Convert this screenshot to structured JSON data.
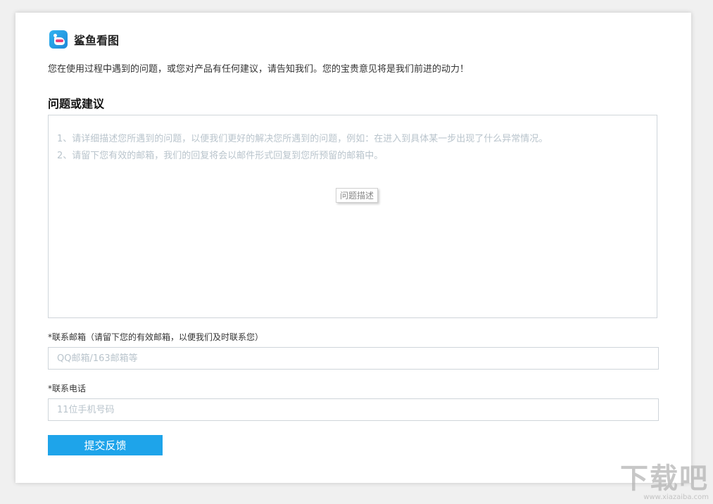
{
  "app": {
    "name": "鲨鱼看图",
    "logo_icon": "shark-logo-icon"
  },
  "intro_text": "您在使用过程中遇到的问题，或您对产品有任何建议，请告知我们。您的宝贵意见将是我们前进的动力！",
  "feedback": {
    "section_title": "问题或建议",
    "placeholder_line1": "1、请详细描述您所遇到的问题，以便我们更好的解决您所遇到的问题，例如：在进入到具体某一步出现了什么异常情况。",
    "placeholder_line2": "2、请留下您有效的邮箱，我们的回复将会以邮件形式回复到您所预留的邮箱中。",
    "tooltip": "问题描述"
  },
  "email": {
    "label": "*联系邮箱（请留下您的有效邮箱，以便我们及时联系您）",
    "placeholder": "QQ邮箱/163邮箱等",
    "value": ""
  },
  "phone": {
    "label": "*联系电话",
    "placeholder": "11位手机号码",
    "value": ""
  },
  "submit_label": "提交反馈",
  "watermark": {
    "text": "下载吧",
    "url": "www.xiazaiba.com"
  },
  "colors": {
    "accent": "#1ea4ea",
    "border": "#cfd5da",
    "placeholder": "#b9c4cc"
  }
}
